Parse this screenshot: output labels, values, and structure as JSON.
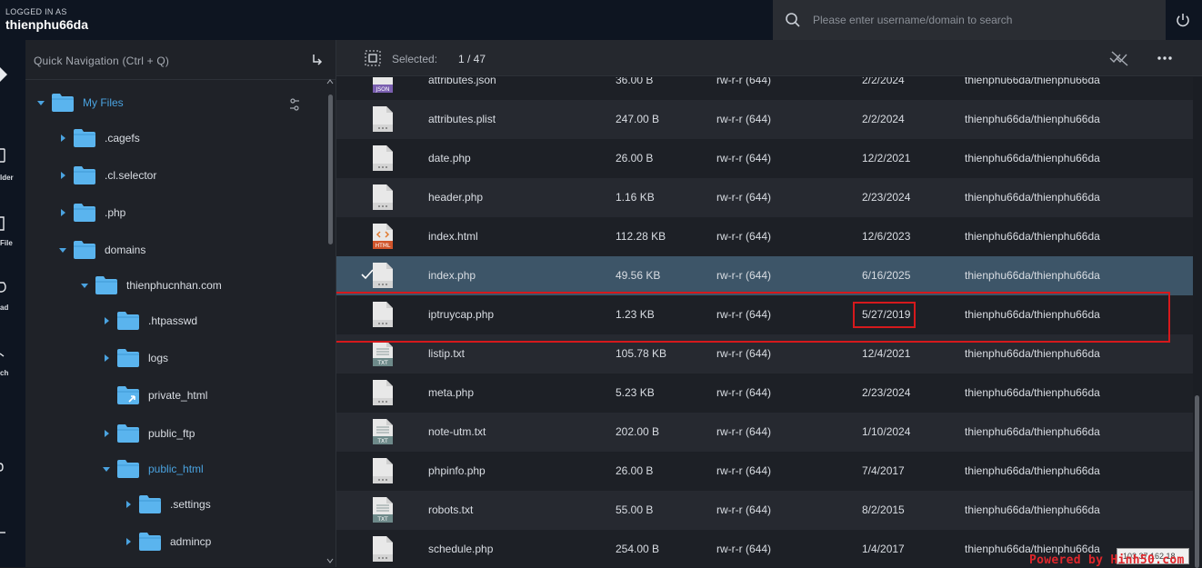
{
  "header": {
    "login_label": "LOGGED IN AS",
    "username": "thienphu66da",
    "search_placeholder": "Please enter username/domain to search"
  },
  "rail": {
    "items": [
      {
        "icon": "play-icon",
        "label": ""
      },
      {
        "icon": "new-folder-icon",
        "label": "lder"
      },
      {
        "icon": "new-file-icon",
        "label": "File"
      },
      {
        "icon": "upload-icon",
        "label": "ad"
      },
      {
        "icon": "search-icon",
        "label": "ch"
      },
      {
        "icon": "link-icon",
        "label": ""
      },
      {
        "icon": "dash-icon",
        "label": ""
      }
    ]
  },
  "tree": {
    "quick_nav_label": "Quick Navigation (Ctrl + Q)",
    "nodes": [
      {
        "name": "My Files",
        "level": 0,
        "expanded": true
      },
      {
        "name": ".cagefs",
        "level": 1,
        "expanded": false
      },
      {
        "name": ".cl.selector",
        "level": 1,
        "expanded": false
      },
      {
        "name": ".php",
        "level": 1,
        "expanded": false
      },
      {
        "name": "domains",
        "level": 1,
        "expanded": true
      },
      {
        "name": "thienphucnhan.com",
        "level": 2,
        "expanded": true
      },
      {
        "name": ".htpasswd",
        "level": 3,
        "expanded": false
      },
      {
        "name": "logs",
        "level": 3,
        "expanded": false
      },
      {
        "name": "private_html",
        "level": 3,
        "expanded": false
      },
      {
        "name": "public_ftp",
        "level": 3,
        "expanded": false
      },
      {
        "name": "public_html",
        "level": 3,
        "expanded": true
      },
      {
        "name": ".settings",
        "level": 4,
        "expanded": false
      },
      {
        "name": "admincp",
        "level": 4,
        "expanded": false
      }
    ]
  },
  "toolbar": {
    "selected_label": "Selected:",
    "selected_count": "1 / 47"
  },
  "files": [
    {
      "name": "attributes.json",
      "size": "36.00 B",
      "perm": "rw-r-r (644)",
      "date": "2/2/2024",
      "owner": "thienphu66da/thienphu66da",
      "type": "json"
    },
    {
      "name": "attributes.plist",
      "size": "247.00 B",
      "perm": "rw-r-r (644)",
      "date": "2/2/2024",
      "owner": "thienphu66da/thienphu66da",
      "type": "generic"
    },
    {
      "name": "date.php",
      "size": "26.00 B",
      "perm": "rw-r-r (644)",
      "date": "12/2/2021",
      "owner": "thienphu66da/thienphu66da",
      "type": "generic"
    },
    {
      "name": "header.php",
      "size": "1.16 KB",
      "perm": "rw-r-r (644)",
      "date": "2/23/2024",
      "owner": "thienphu66da/thienphu66da",
      "type": "generic"
    },
    {
      "name": "index.html",
      "size": "112.28 KB",
      "perm": "rw-r-r (644)",
      "date": "12/6/2023",
      "owner": "thienphu66da/thienphu66da",
      "type": "html"
    },
    {
      "name": "index.php",
      "size": "49.56 KB",
      "perm": "rw-r-r (644)",
      "date": "6/16/2025",
      "owner": "thienphu66da/thienphu66da",
      "type": "generic",
      "selected": true
    },
    {
      "name": "iptruycap.php",
      "size": "1.23 KB",
      "perm": "rw-r-r (644)",
      "date": "5/27/2019",
      "owner": "thienphu66da/thienphu66da",
      "type": "generic"
    },
    {
      "name": "listip.txt",
      "size": "105.78 KB",
      "perm": "rw-r-r (644)",
      "date": "12/4/2021",
      "owner": "thienphu66da/thienphu66da",
      "type": "txt"
    },
    {
      "name": "meta.php",
      "size": "5.23 KB",
      "perm": "rw-r-r (644)",
      "date": "2/23/2024",
      "owner": "thienphu66da/thienphu66da",
      "type": "generic"
    },
    {
      "name": "note-utm.txt",
      "size": "202.00 B",
      "perm": "rw-r-r (644)",
      "date": "1/10/2024",
      "owner": "thienphu66da/thienphu66da",
      "type": "txt"
    },
    {
      "name": "phpinfo.php",
      "size": "26.00 B",
      "perm": "rw-r-r (644)",
      "date": "7/4/2017",
      "owner": "thienphu66da/thienphu66da",
      "type": "generic"
    },
    {
      "name": "robots.txt",
      "size": "55.00 B",
      "perm": "rw-r-r (644)",
      "date": "8/2/2015",
      "owner": "thienphu66da/thienphu66da",
      "type": "txt"
    },
    {
      "name": "schedule.php",
      "size": "254.00 B",
      "perm": "rw-r-r (644)",
      "date": "1/4/2017",
      "owner": "thienphu66da/thienphu66da",
      "type": "generic"
    }
  ],
  "footer": {
    "ip": "103.37.162.18",
    "watermark": "Powered by Hinh50.com"
  },
  "colors": {
    "accent": "#4aa3e0",
    "folder": "#5ab4ee",
    "selected_row": "#3d5568",
    "highlight_box": "#d6191c"
  }
}
